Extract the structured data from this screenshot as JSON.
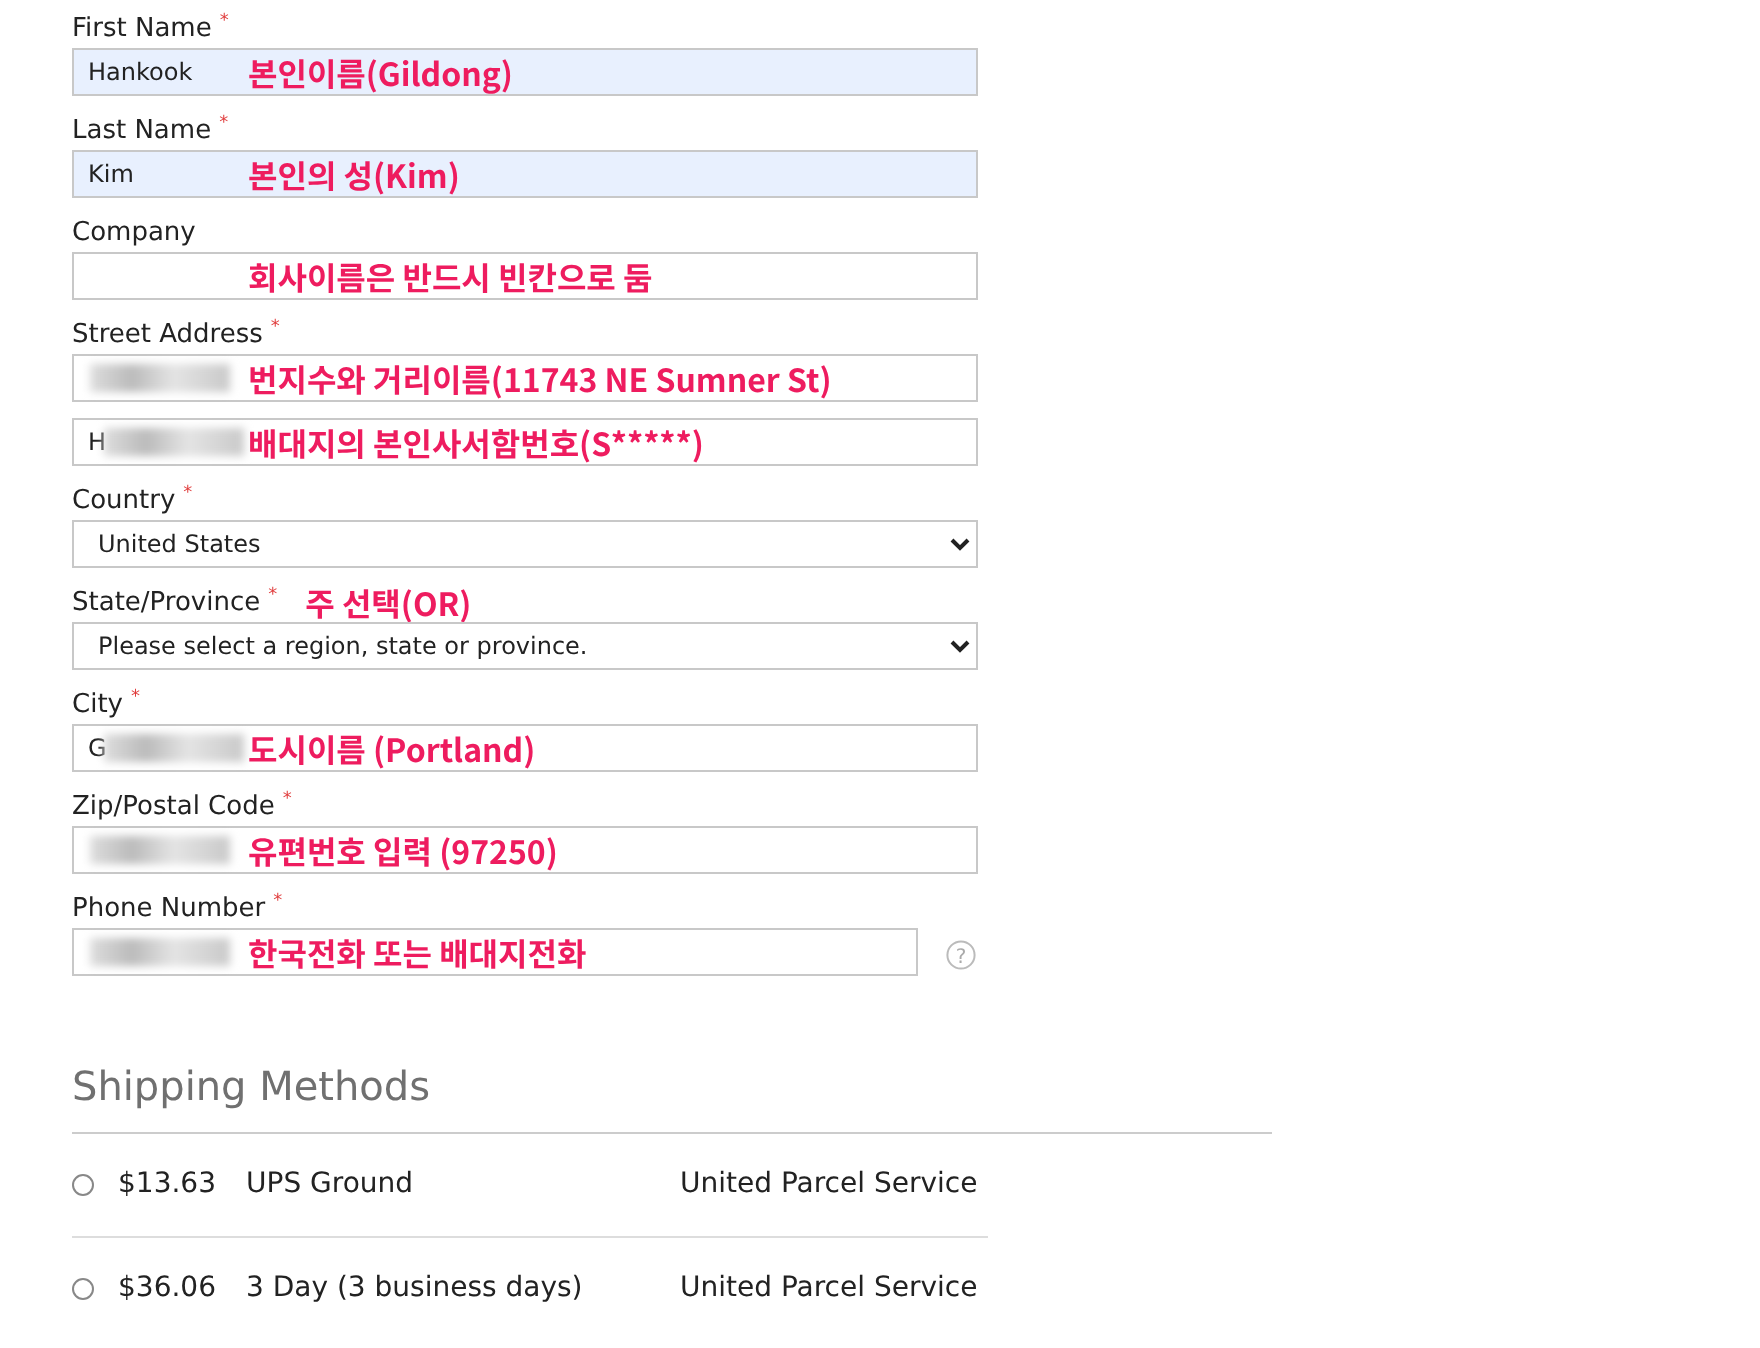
{
  "fields": [
    {
      "kind": "text",
      "label": "First Name",
      "required_mark": "*",
      "value": "Hankook",
      "autofilled": true,
      "redacted": false,
      "annotation": "본인이름(Gildong)"
    },
    {
      "kind": "text",
      "label": "Last Name",
      "required_mark": "*",
      "value": "Kim",
      "autofilled": true,
      "redacted": false,
      "annotation": "본인의 성(Kim)"
    },
    {
      "kind": "text",
      "label": "Company",
      "autofilled": false,
      "redacted": false,
      "annotation": "회사이름은 반드시 빈칸으로 둠"
    },
    {
      "kind": "text",
      "label": "Street Address",
      "required_mark": "*",
      "autofilled": false,
      "redacted": true,
      "annotation": "번지수와 거리이름(11743 NE Sumner St)"
    },
    {
      "kind": "text",
      "value": "H",
      "autofilled": false,
      "redacted": true,
      "annotation": "배대지의 본인사서함번호(S*****)"
    },
    {
      "kind": "select",
      "label": "Country",
      "required_mark": "*",
      "value": "United States"
    },
    {
      "kind": "select",
      "label": "State/Province",
      "required_mark": "*",
      "value": "Please select a region, state or province.",
      "annotation": "주 선택(OR)"
    },
    {
      "kind": "text",
      "label": "City",
      "required_mark": "*",
      "value": "G",
      "autofilled": false,
      "redacted": true,
      "annotation": "도시이름 (Portland)"
    },
    {
      "kind": "text",
      "label": "Zip/Postal Code",
      "required_mark": "*",
      "autofilled": false,
      "redacted": true,
      "annotation": "유편번호 입력 (97250)"
    },
    {
      "kind": "text",
      "label": "Phone Number",
      "required_mark": "*",
      "autofilled": false,
      "redacted": true,
      "help": "?",
      "annotation": "한국전화 또는 배대지전화"
    }
  ],
  "shipping": {
    "title": "Shipping Methods",
    "methods": [
      {
        "selected": false,
        "price": "$13.63",
        "name": "UPS Ground",
        "carrier": "United Parcel Service"
      },
      {
        "selected": false,
        "price": "$36.06",
        "name": "3 Day (3 business days)",
        "carrier": "United Parcel Service"
      }
    ]
  }
}
